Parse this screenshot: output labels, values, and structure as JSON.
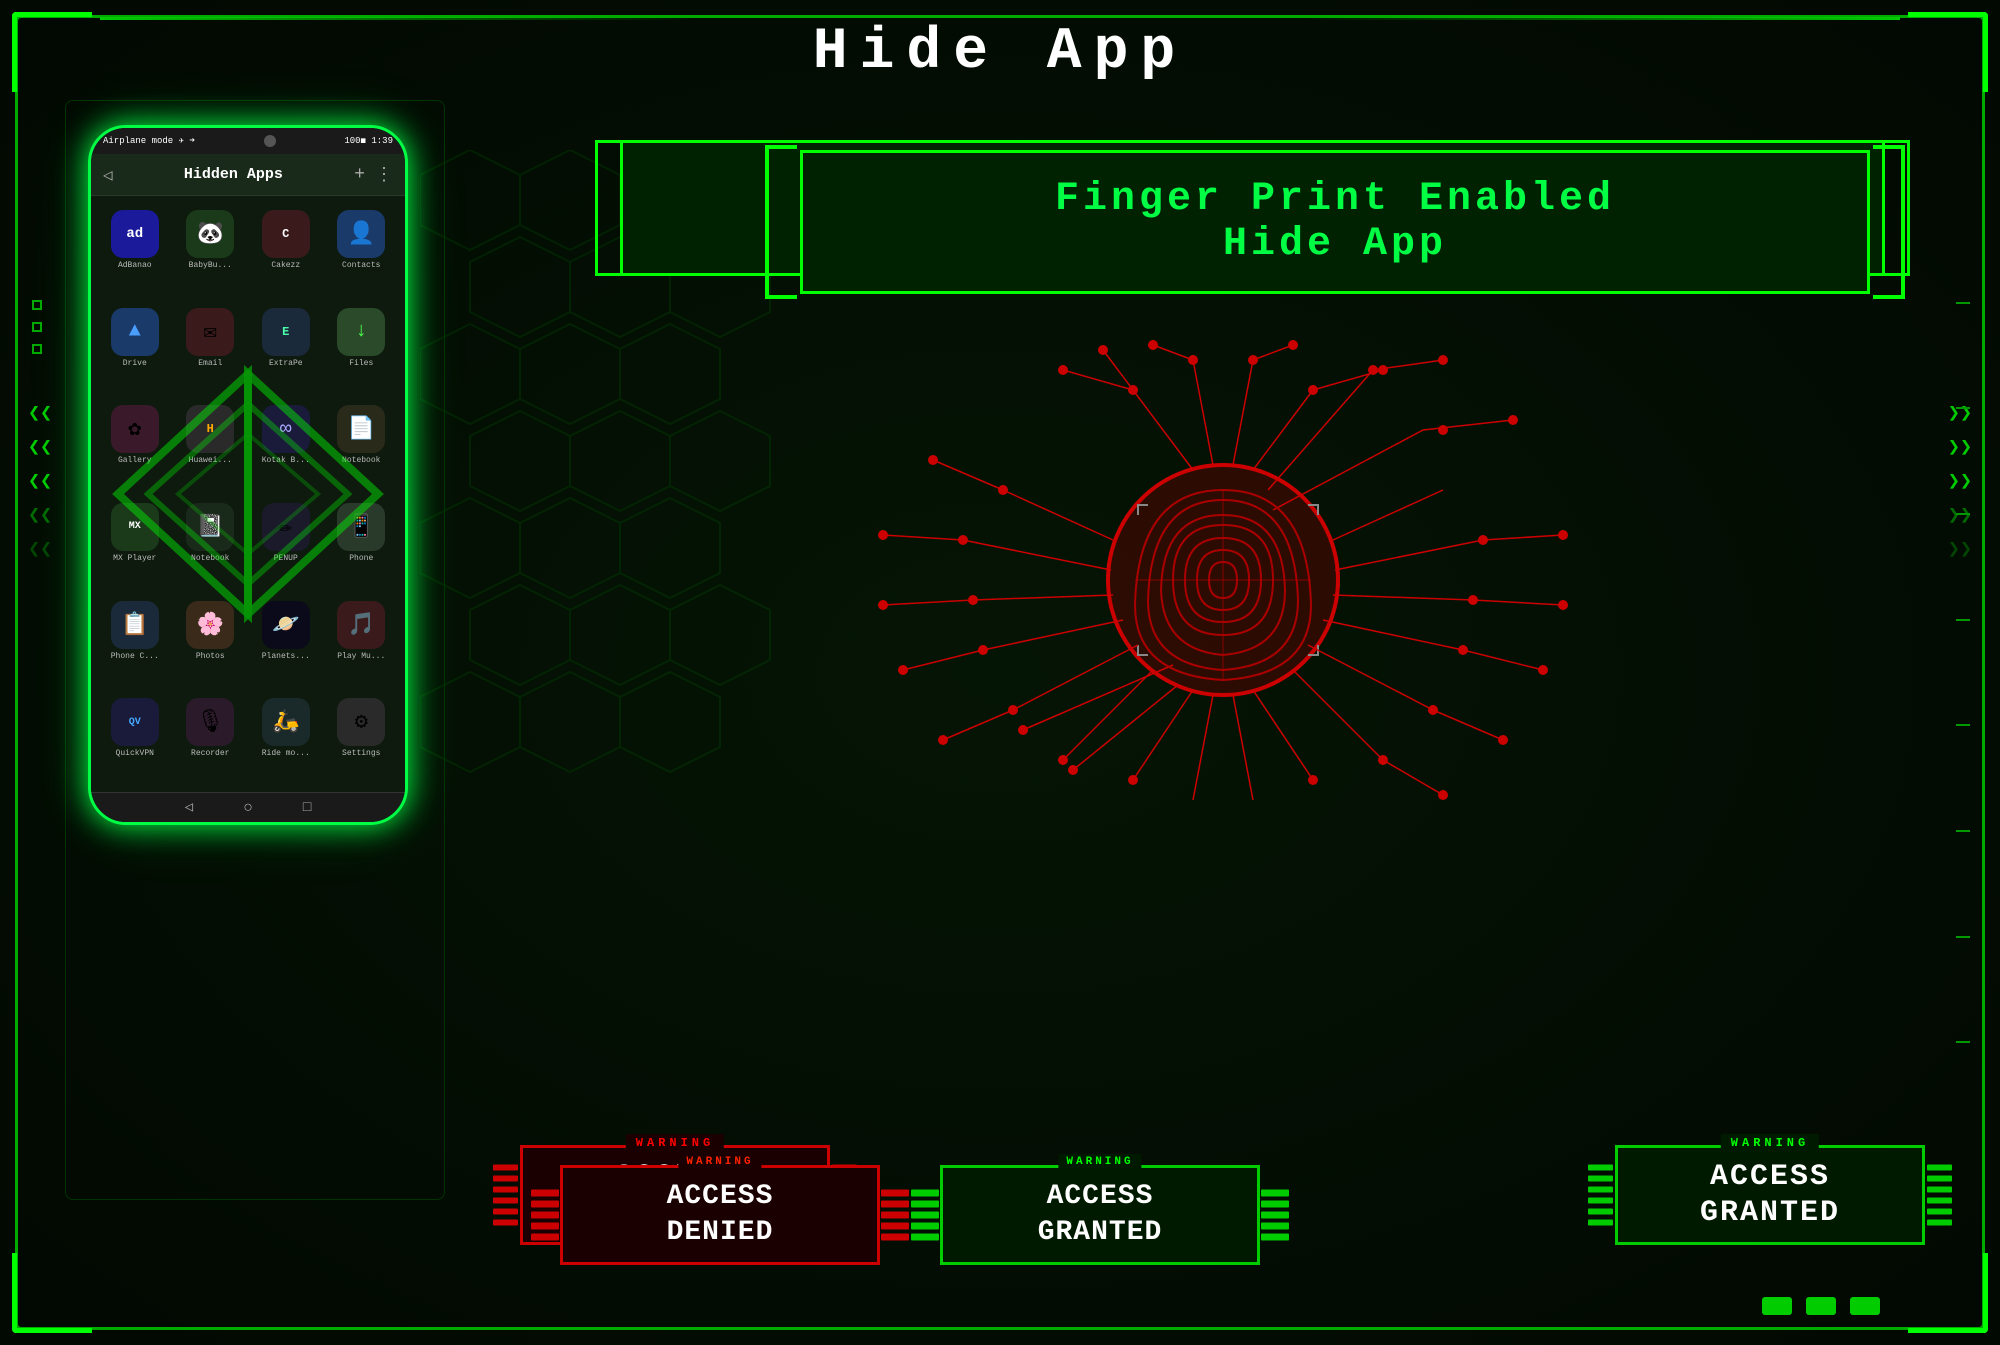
{
  "page": {
    "title": "Hide App",
    "bg_color": "#030f03",
    "border_color": "#00cc00"
  },
  "fingerprint_section": {
    "title_line1": "Finger Print Enabled",
    "title_line2": "Hide App"
  },
  "phone": {
    "status_bar": {
      "left": "Airplane mode ✈ ➜",
      "center": "●",
      "right": "100◼ 1:39"
    },
    "title_bar": "Hidden Apps",
    "apps": [
      {
        "name": "AdBanao",
        "color": "#1a1a9a",
        "label": "ad"
      },
      {
        "name": "BabyBu...",
        "color": "#1a4a2a",
        "label": "🐼"
      },
      {
        "name": "Cakezz",
        "color": "#2a1a1a",
        "label": "C"
      },
      {
        "name": "Contacts",
        "color": "#1a3a6a",
        "label": "👤"
      },
      {
        "name": "Drive",
        "color": "#1a3a6a",
        "label": "▲"
      },
      {
        "name": "Email",
        "color": "#3a1a1a",
        "label": "✉"
      },
      {
        "name": "ExtraPe",
        "color": "#1a2a3a",
        "label": "E"
      },
      {
        "name": "Files",
        "color": "#2a4a2a",
        "label": "↓"
      },
      {
        "name": "Gallery",
        "color": "#3a1a2a",
        "label": "✿"
      },
      {
        "name": "Huawei...",
        "color": "#2a2a2a",
        "label": "H"
      },
      {
        "name": "Kotak B...",
        "color": "#1a1a3a",
        "label": "∞"
      },
      {
        "name": "Notebook",
        "color": "#2a2a1a",
        "label": "📄"
      },
      {
        "name": "MX Player",
        "color": "#1a3a1a",
        "label": "MX"
      },
      {
        "name": "Notebook",
        "color": "#1a2a1a",
        "label": "📓"
      },
      {
        "name": "PENUP",
        "color": "#1a1a2a",
        "label": "✏"
      },
      {
        "name": "Phone",
        "color": "#2a3a2a",
        "label": "📱"
      },
      {
        "name": "Phone C...",
        "color": "#1a2a3a",
        "label": "📋"
      },
      {
        "name": "Photos",
        "color": "#3a2a1a",
        "label": "🌸"
      },
      {
        "name": "Planets...",
        "color": "#0a0a1a",
        "label": "🪐"
      },
      {
        "name": "Play Mu...",
        "color": "#3a1a1a",
        "label": "🎵"
      },
      {
        "name": "QuickVPN",
        "color": "#1a1a3a",
        "label": "QV"
      },
      {
        "name": "Recorder",
        "color": "#2a1a2a",
        "label": "🎙"
      },
      {
        "name": "Ride mo...",
        "color": "#1a2a2a",
        "label": "🛵"
      },
      {
        "name": "Settings",
        "color": "#2a2a2a",
        "label": "⚙"
      }
    ]
  },
  "access_denied": {
    "warning": "WARNING",
    "text_line1": "ACCESS",
    "text_line2": "DENIED"
  },
  "access_granted": {
    "warning": "WARNING",
    "text_line1": "ACCESS",
    "text_line2": "GRANTED"
  },
  "bottom_dots": {
    "count": 3
  },
  "icons": {
    "back_arrow": "◁",
    "add": "+",
    "menu": "⋮",
    "nav_back": "◁",
    "nav_home": "○",
    "nav_recent": "□"
  }
}
